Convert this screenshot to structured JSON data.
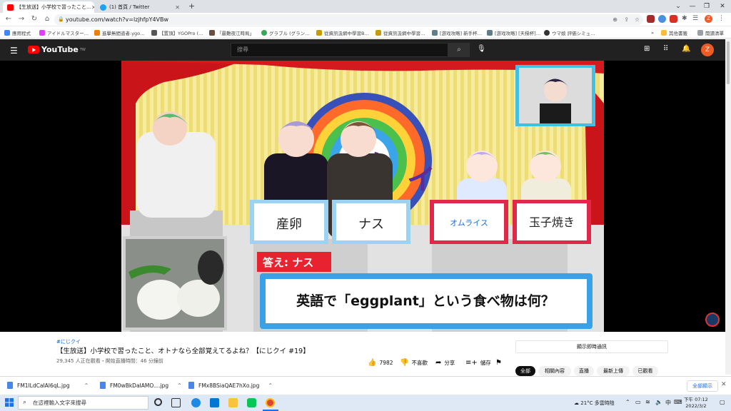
{
  "tabs": [
    {
      "label": "【生放送】小学校で習ったこと…",
      "active": true
    },
    {
      "label": "(1) 首頁 / Twitter",
      "active": false
    }
  ],
  "new_tab_label": "+",
  "address": {
    "url": "youtube.com/watch?v=lzjhfpY4VBw"
  },
  "bookmarks": [
    "應用程式",
    "アイドルマスター…",
    "進擊無間道者:ygo…",
    "【置頂】YGOPro (…",
    "「最難夜江時局」",
    "グラブル (グラン…",
    "從資訊汲網中學習B…",
    "從資訊汲網中學習…",
    "[游戏攻略] 新手杯…",
    "[游戏攻略] [天梯杯]…",
    "ウマ娘 評価シミュ…",
    "其他書籤",
    "閱讀清單"
  ],
  "youtube": {
    "logo_text": "YouTube",
    "region": "TW",
    "search_placeholder": "搜尋",
    "avatar_letter": "Z"
  },
  "video": {
    "answer_label": "答え: ナス",
    "question": "英語で「eggplant」という食べ物は何？",
    "cards": [
      "産卵",
      "ナス",
      "オムライス",
      "玉子焼き"
    ]
  },
  "info": {
    "hashtag": "#にじクイ",
    "title": "【生放送】小学校で習ったこと、オトナなら全部覚えてるよね？【にじクイ #19】",
    "meta": "29,345 人正在觀看・開始直播時間：46 分鐘前",
    "likes": "7982",
    "dislike": "不喜歡",
    "share": "分享",
    "save": "儲存",
    "chat_button": "顯示即時通訊"
  },
  "chips": [
    "全部",
    "相關內容",
    "直播",
    "最新上傳",
    "已觀看"
  ],
  "downloads": [
    "FM1lLdCaIAI6qL.jpg",
    "FM0wBkDaIAMO....jpg",
    "FMx8BSiaQAE7hXo.jpg"
  ],
  "show_all_label": "全部顯示",
  "taskbar": {
    "search_placeholder": "在這裡輸入文字來搜尋",
    "weather": "21°C  多雲時陰",
    "time": "下午 07:12",
    "date": "2022/3/2"
  },
  "colors": {
    "youtube_red": "#ff0000",
    "yt_header": "#212121",
    "link_blue": "#065fd4",
    "avatar_orange": "#ef5b25"
  }
}
